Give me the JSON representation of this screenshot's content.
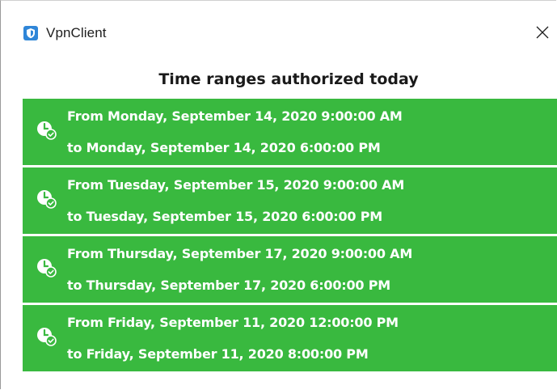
{
  "window": {
    "title": "VpnClient",
    "app_icon": "shield-icon",
    "close_icon": "close-icon"
  },
  "heading": "Time ranges authorized today",
  "colors": {
    "range_background": "#39b93f",
    "range_text": "#ffffff",
    "app_icon": "#2f86d8"
  },
  "ranges": [
    {
      "icon": "clock-check-icon",
      "from": "From Monday, September 14, 2020 9:00:00 AM",
      "to": "to Monday, September 14, 2020 6:00:00 PM"
    },
    {
      "icon": "clock-check-icon",
      "from": "From Tuesday, September 15, 2020 9:00:00 AM",
      "to": "to Tuesday, September 15, 2020 6:00:00 PM"
    },
    {
      "icon": "clock-check-icon",
      "from": "From Thursday, September 17, 2020 9:00:00 AM",
      "to": "to Thursday, September 17, 2020 6:00:00 PM"
    },
    {
      "icon": "clock-check-icon",
      "from": "From Friday, September 11, 2020 12:00:00 PM",
      "to": "to Friday, September 11, 2020 8:00:00 PM"
    }
  ]
}
